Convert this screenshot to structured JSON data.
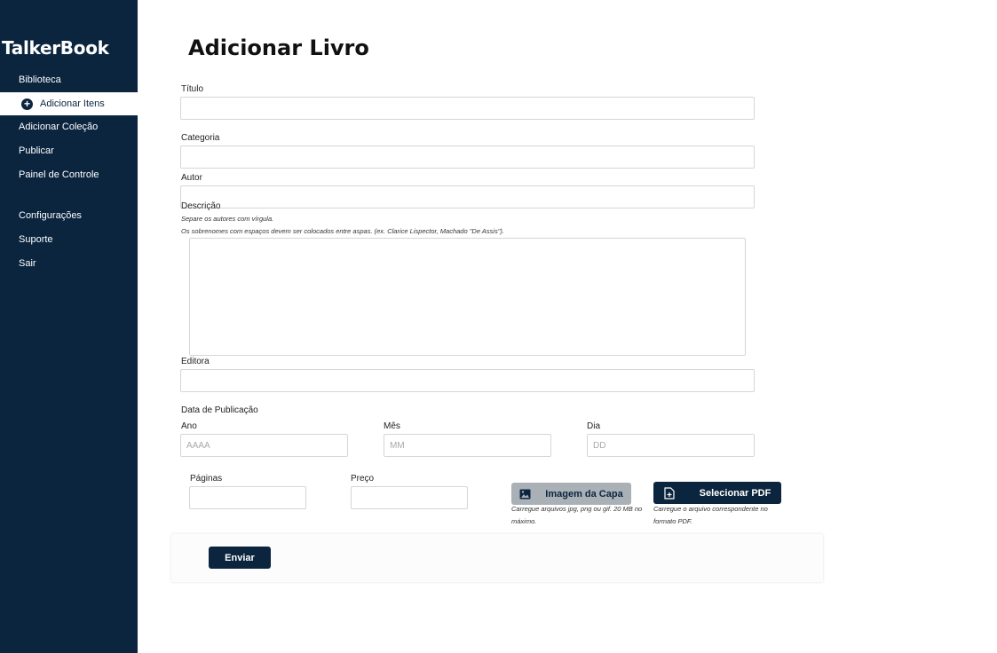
{
  "app": {
    "brand": "TalkerBook"
  },
  "sidebar": {
    "items": [
      {
        "label": "Biblioteca"
      },
      {
        "label": "Adicionar Itens",
        "active": true,
        "icon": "plus-circle-icon"
      },
      {
        "label": "Adicionar Coleção"
      },
      {
        "label": "Publicar"
      },
      {
        "label": "Painel de Controle"
      },
      {
        "label": "Configurações"
      },
      {
        "label": "Suporte"
      },
      {
        "label": "Sair"
      }
    ]
  },
  "page": {
    "title": "Adicionar Livro"
  },
  "form": {
    "titulo": {
      "label": "Título",
      "value": ""
    },
    "categoria": {
      "label": "Categoria",
      "value": ""
    },
    "autor": {
      "label": "Autor",
      "value": ""
    },
    "descricao": {
      "label": "Descrição",
      "hint1": "Separe os autores com vírgula.",
      "hint2": "Os sobrenomes com espaços devem ser colocados entre aspas. (ex. Clarice Lispector, Machado \"De Assis\").",
      "value": ""
    },
    "editora": {
      "label": "Editora",
      "value": ""
    },
    "data_publicacao": {
      "label": "Data de Publicação",
      "ano": {
        "label": "Ano",
        "placeholder": "AAAA"
      },
      "mes": {
        "label": "Mês",
        "placeholder": "MM"
      },
      "dia": {
        "label": "Dia",
        "placeholder": "DD"
      }
    },
    "paginas": {
      "label": "Páginas",
      "value": ""
    },
    "preco": {
      "label": "Preço",
      "value": ""
    },
    "imagem_capa": {
      "label": "Imagem da Capa",
      "icon": "image-icon",
      "hint": "Carregue arquivos jpg, png ou gif. 20 MB no máximo."
    },
    "pdf": {
      "label": "Selecionar PDF",
      "icon": "file-plus-icon",
      "hint": "Carregue o arquivo correspondente no formato PDF."
    },
    "submit_label": "Enviar"
  },
  "colors": {
    "sidebar_bg": "#0b253f",
    "accent": "#0b253f",
    "secondary_button": "#a9b0b6"
  }
}
